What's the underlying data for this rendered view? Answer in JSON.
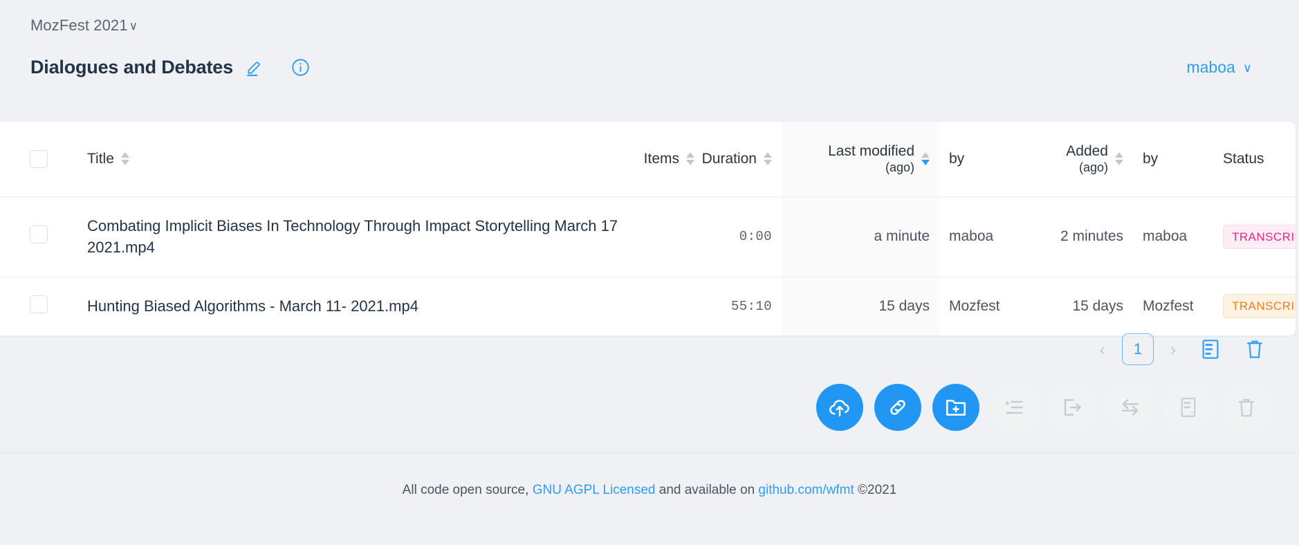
{
  "header": {
    "breadcrumb": "MozFest 2021",
    "breadcrumb_chevron": "∨",
    "title": "Dialogues and Debates",
    "edit_icon": "pencil-icon",
    "info_icon": "info-circle-icon",
    "user": "maboa",
    "user_chevron": "∨"
  },
  "table": {
    "columns": [
      {
        "label": "",
        "sub": "",
        "align": "center",
        "sortable": false
      },
      {
        "label": "Title",
        "sub": "",
        "align": "left",
        "sortable": true,
        "sort": "none"
      },
      {
        "label": "Items",
        "sub": "",
        "align": "right",
        "sortable": true,
        "sort": "none"
      },
      {
        "label": "Duration",
        "sub": "",
        "align": "right",
        "sortable": true,
        "sort": "none"
      },
      {
        "label": "Last modified",
        "sub": "(ago)",
        "align": "right",
        "sortable": true,
        "sort": "desc"
      },
      {
        "label": "by",
        "sub": "",
        "align": "left",
        "sortable": false
      },
      {
        "label": "Added",
        "sub": "(ago)",
        "align": "right",
        "sortable": true,
        "sort": "none"
      },
      {
        "label": "by",
        "sub": "",
        "align": "left",
        "sortable": false
      },
      {
        "label": "Status",
        "sub": "",
        "align": "left",
        "sortable": false
      },
      {
        "label": "",
        "sub": "",
        "align": "right",
        "sortable": false,
        "icon": "filter-funnel-icon"
      }
    ],
    "rows": [
      {
        "checked": false,
        "title": "Combating Implicit Biases In Technology Through Impact Storytelling March 17 2021.mp4",
        "items": "",
        "duration": "0:00",
        "last_modified": "a minute",
        "modified_by": "maboa",
        "added": "2 minutes",
        "added_by": "maboa",
        "status": "TRANSCRIBING",
        "status_kind": "transcribing"
      },
      {
        "checked": false,
        "title": "Hunting Biased Algorithms - March 11- 2021.mp4",
        "items": "",
        "duration": "55:10",
        "last_modified": "15 days",
        "modified_by": "Mozfest",
        "added": "15 days",
        "added_by": "Mozfest",
        "status": "TRANSCRIBED",
        "status_kind": "transcribed"
      }
    ]
  },
  "pagination": {
    "prev": "‹",
    "page": "1",
    "next": "›",
    "tools": [
      {
        "name": "server-icon",
        "enabled": true
      },
      {
        "name": "trash-icon",
        "enabled": true
      }
    ]
  },
  "actions": [
    {
      "name": "cloud-upload-icon",
      "enabled": true
    },
    {
      "name": "link-icon",
      "enabled": true
    },
    {
      "name": "folder-add-icon",
      "enabled": true
    },
    {
      "name": "indent-list-icon",
      "enabled": false
    },
    {
      "name": "export-icon",
      "enabled": false
    },
    {
      "name": "transfer-swap-icon",
      "enabled": false
    },
    {
      "name": "server-icon",
      "enabled": false
    },
    {
      "name": "trash-icon",
      "enabled": false
    }
  ],
  "footer": {
    "text_before": "All code open source,",
    "link1": "GNU AGPL Licensed",
    "text_middle": "and available on",
    "link2": "github.com/wfmt",
    "copyright": "©2021"
  },
  "colors": {
    "accent": "#2196f3",
    "page_bg": "#eff1f5",
    "title": "#243447",
    "transcribing_fg": "#e8277f",
    "transcribing_bg": "#fdeef5",
    "transcribed_fg": "#f08020",
    "transcribed_bg": "#fdf3e3"
  }
}
